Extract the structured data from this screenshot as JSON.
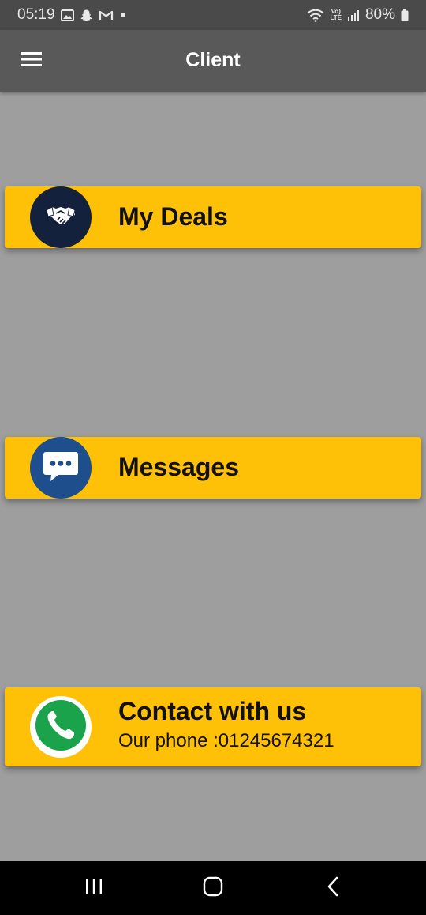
{
  "status_bar": {
    "time": "05:19",
    "battery": "80%",
    "network": "LTE"
  },
  "toolbar": {
    "title": "Client"
  },
  "cards": [
    {
      "title": "My Deals",
      "icon": "handshake-icon",
      "icon_bg": "#14213d"
    },
    {
      "title": "Messages",
      "icon": "chat-bubble-icon",
      "icon_bg": "#1e4f8c"
    },
    {
      "title": "Contact with us",
      "subtitle": "Our phone :01245674321",
      "icon": "whatsapp-phone-icon",
      "icon_bg": "#1aa34a"
    }
  ],
  "colors": {
    "background": "#9e9e9e",
    "toolbar": "#595959",
    "card": "#ffc107"
  }
}
